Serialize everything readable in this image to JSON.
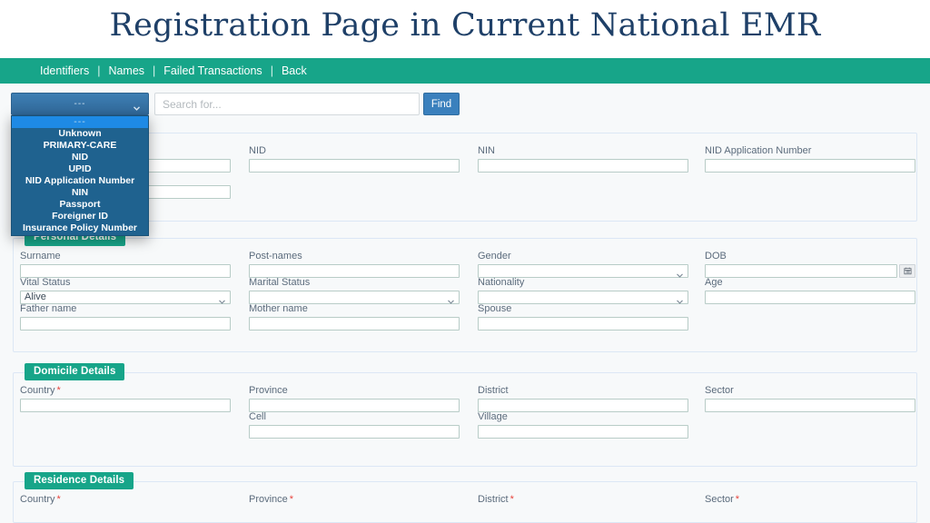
{
  "slide": {
    "title": "Registration Page in Current National EMR",
    "title_color": "#1f4068"
  },
  "theme": {
    "navbar_color": "#17a589",
    "legend_color": "#17a589",
    "primary_button_color": "#3a80bd",
    "dropdown_color": "#1f628f",
    "dropdown_selected_color": "#1e8ae5",
    "required_marker_color": "#e8443c",
    "panel_background": "#f7f9fa",
    "panel_border": "#dce7f5"
  },
  "navbar": {
    "links": [
      {
        "label": "Identifiers",
        "name": "nav-link-identifiers"
      },
      {
        "label": "Names",
        "name": "nav-link-names"
      },
      {
        "label": "Failed Transactions",
        "name": "nav-link-failed-transactions"
      },
      {
        "label": "Back",
        "name": "nav-link-back"
      }
    ],
    "separator": "|"
  },
  "search": {
    "identifier_select_value": "---",
    "placeholder": "Search for...",
    "input_value": "",
    "find_label": "Find",
    "dropdown_open": true,
    "dropdown_options": [
      "---",
      "Unknown",
      "PRIMARY-CARE",
      "NID",
      "UPID",
      "NID Application Number",
      "NIN",
      "Passport",
      "Foreigner ID",
      "Insurance Policy Number"
    ],
    "dropdown_selected_index": 0
  },
  "sections": [
    {
      "id": "identifiers",
      "legend": "",
      "legend_hidden": true,
      "fields": [
        {
          "label": "",
          "label_hidden": true,
          "type": "text",
          "value": "",
          "required": false,
          "col": 1,
          "row": 1,
          "name": "identifier-field-1"
        },
        {
          "label": "",
          "label_hidden": true,
          "type": "text",
          "value": "",
          "required": false,
          "col": 1,
          "row": 2,
          "name": "identifier-field-2"
        },
        {
          "label": "NID",
          "type": "text",
          "value": "",
          "required": false,
          "col": 2,
          "row": 1,
          "name": "nid-field"
        },
        {
          "label": "NIN",
          "type": "text",
          "value": "",
          "required": false,
          "col": 3,
          "row": 1,
          "name": "nin-field"
        },
        {
          "label": "NID Application Number",
          "type": "text",
          "value": "",
          "required": false,
          "col": 4,
          "row": 1,
          "name": "nid-application-number-field"
        }
      ]
    },
    {
      "id": "personal-details",
      "legend": "Personal Details",
      "fields": [
        {
          "label": "Surname",
          "type": "text",
          "value": "",
          "required": false,
          "col": 1,
          "row": 1,
          "name": "surname-field"
        },
        {
          "label": "Vital Status",
          "type": "select",
          "value": "Alive",
          "required": false,
          "col": 1,
          "row": 2,
          "name": "vital-status-select"
        },
        {
          "label": "Father name",
          "type": "text",
          "value": "",
          "required": false,
          "col": 1,
          "row": 3,
          "name": "father-name-field"
        },
        {
          "label": "Post-names",
          "type": "text",
          "value": "",
          "required": false,
          "col": 2,
          "row": 1,
          "name": "post-names-field"
        },
        {
          "label": "Marital Status",
          "type": "select",
          "value": "",
          "required": false,
          "col": 2,
          "row": 2,
          "name": "marital-status-select"
        },
        {
          "label": "Mother name",
          "type": "text",
          "value": "",
          "required": false,
          "col": 2,
          "row": 3,
          "name": "mother-name-field"
        },
        {
          "label": "Gender",
          "type": "select",
          "value": "",
          "required": false,
          "col": 3,
          "row": 1,
          "name": "gender-select"
        },
        {
          "label": "Nationality",
          "type": "select",
          "value": "",
          "required": false,
          "col": 3,
          "row": 2,
          "name": "nationality-select"
        },
        {
          "label": "Spouse",
          "type": "text",
          "value": "",
          "required": false,
          "col": 3,
          "row": 3,
          "name": "spouse-field"
        },
        {
          "label": "DOB",
          "type": "date",
          "value": "",
          "required": false,
          "col": 4,
          "row": 1,
          "name": "dob-field"
        },
        {
          "label": "Age",
          "type": "text",
          "value": "",
          "required": false,
          "col": 4,
          "row": 2,
          "name": "age-field"
        }
      ]
    },
    {
      "id": "domicile-details",
      "legend": "Domicile Details",
      "fields": [
        {
          "label": "Country",
          "type": "text",
          "value": "",
          "required": true,
          "col": 1,
          "row": 1,
          "name": "domicile-country-field"
        },
        {
          "label": "Province",
          "type": "text",
          "value": "",
          "required": false,
          "col": 2,
          "row": 1,
          "name": "domicile-province-field"
        },
        {
          "label": "Cell",
          "type": "text",
          "value": "",
          "required": false,
          "col": 2,
          "row": 2,
          "name": "domicile-cell-field"
        },
        {
          "label": "District",
          "type": "text",
          "value": "",
          "required": false,
          "col": 3,
          "row": 1,
          "name": "domicile-district-field"
        },
        {
          "label": "Village",
          "type": "text",
          "value": "",
          "required": false,
          "col": 3,
          "row": 2,
          "name": "domicile-village-field"
        },
        {
          "label": "Sector",
          "type": "text",
          "value": "",
          "required": false,
          "col": 4,
          "row": 1,
          "name": "domicile-sector-field"
        }
      ]
    },
    {
      "id": "residence-details",
      "legend": "Residence Details",
      "fields": [
        {
          "label": "Country",
          "type": "label-only",
          "value": "",
          "required": true,
          "col": 1,
          "row": 1,
          "name": "residence-country-field"
        },
        {
          "label": "Province",
          "type": "label-only",
          "value": "",
          "required": true,
          "col": 2,
          "row": 1,
          "name": "residence-province-field"
        },
        {
          "label": "District",
          "type": "label-only",
          "value": "",
          "required": true,
          "col": 3,
          "row": 1,
          "name": "residence-district-field"
        },
        {
          "label": "Sector",
          "type": "label-only",
          "value": "",
          "required": true,
          "col": 4,
          "row": 1,
          "name": "residence-sector-field"
        }
      ]
    }
  ],
  "icons": {
    "chevron_down": "chevron-down-icon",
    "calendar": "calendar-icon"
  }
}
